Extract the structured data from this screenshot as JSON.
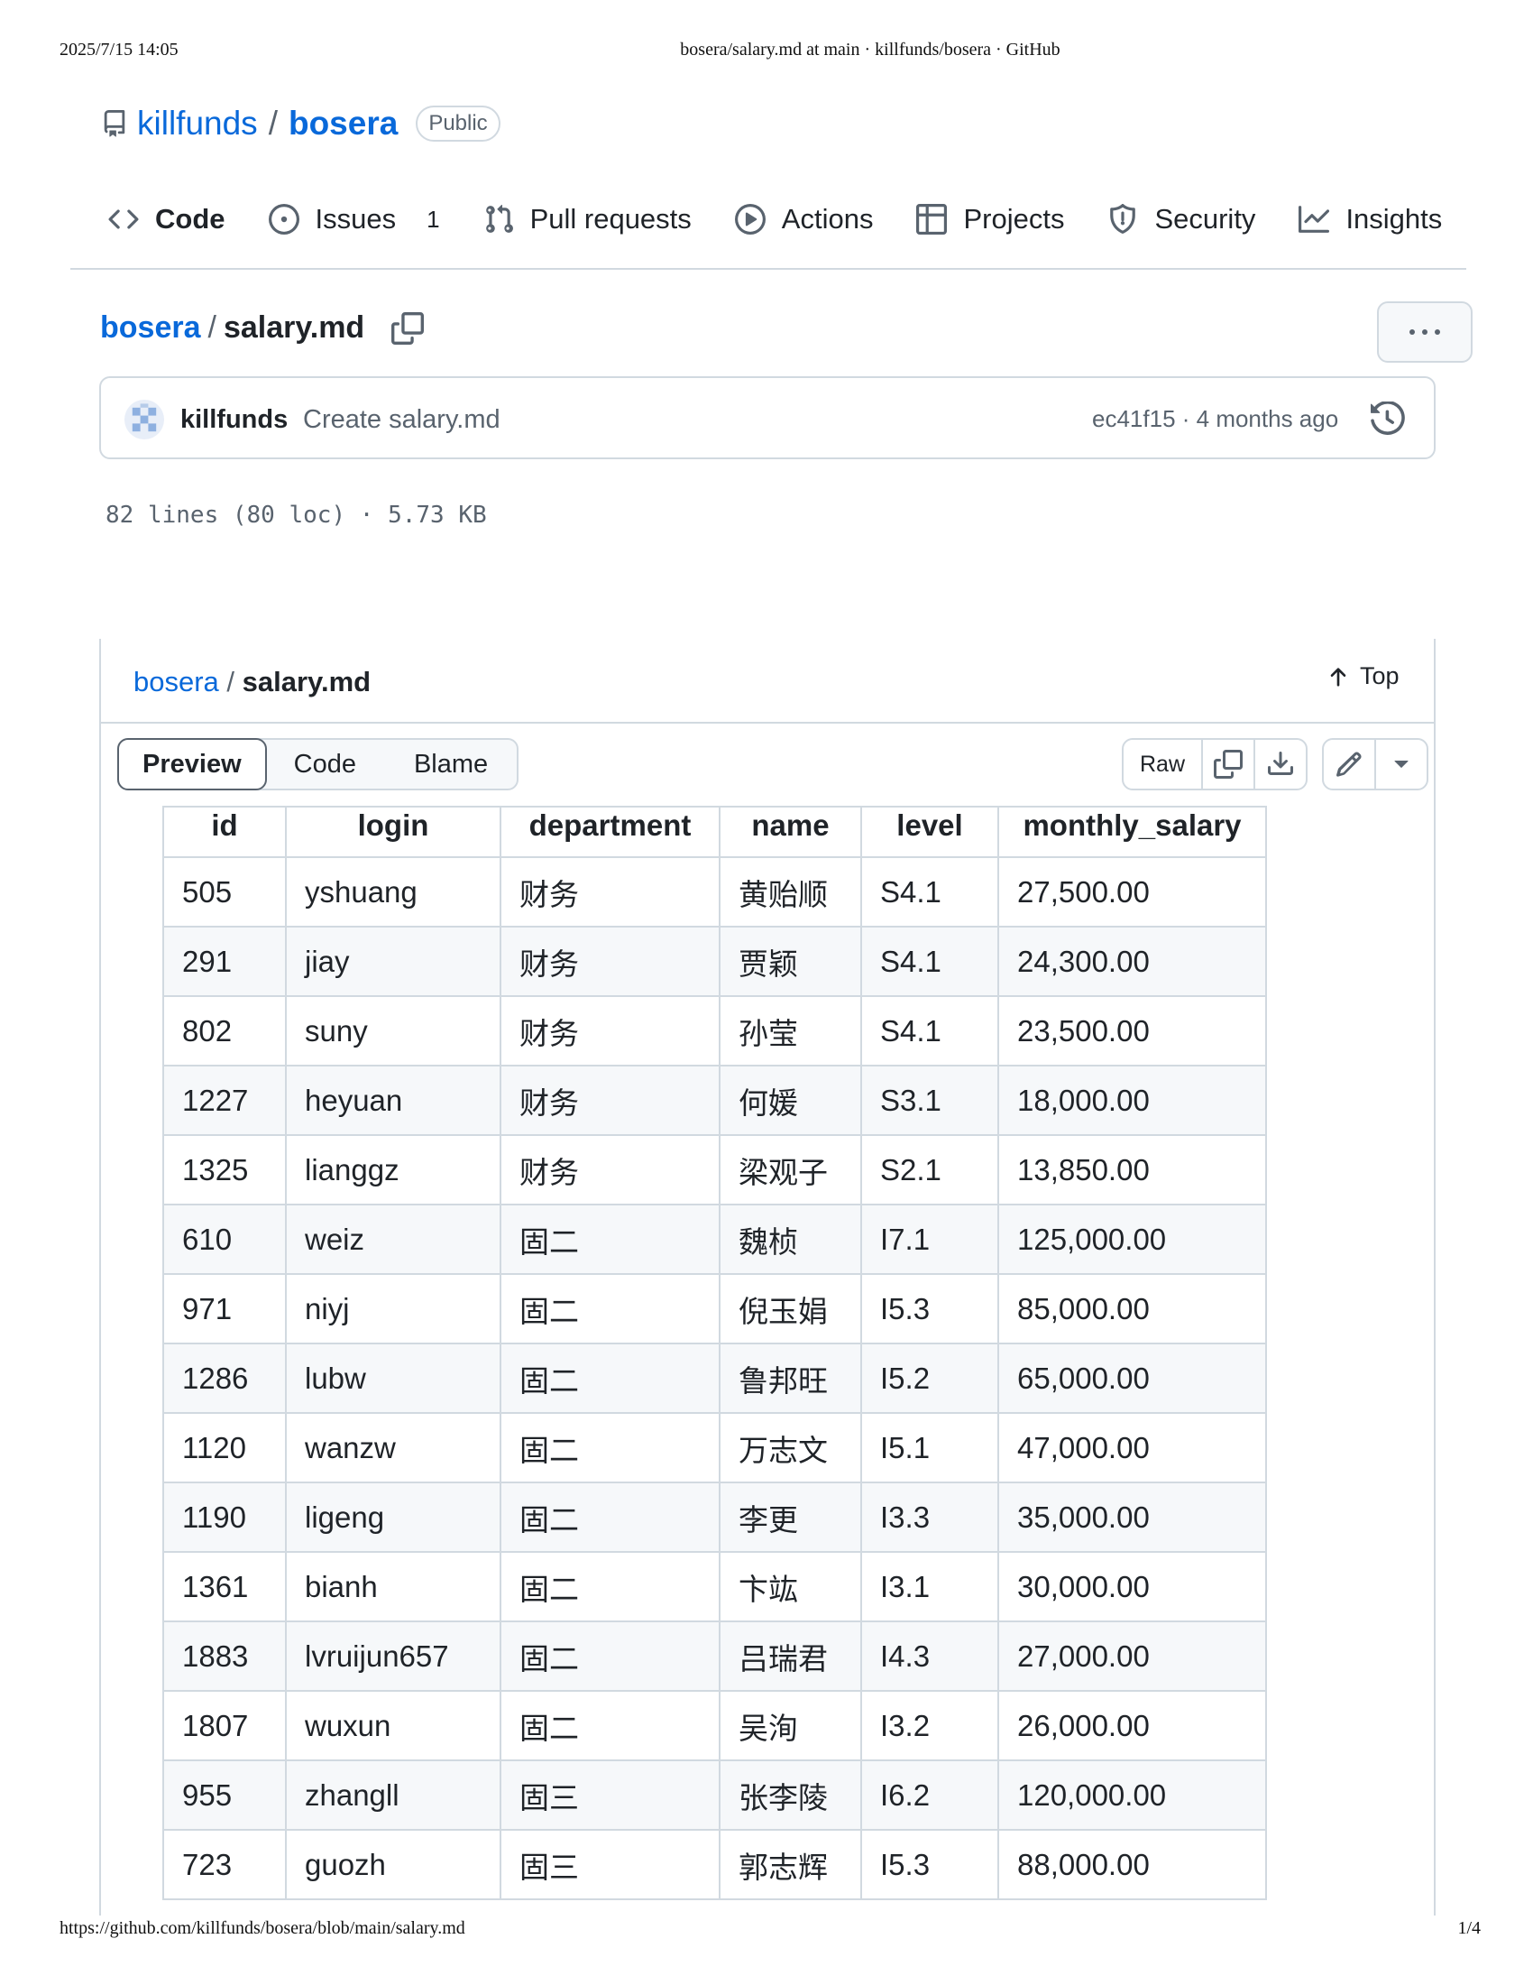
{
  "print_header": {
    "datetime": "2025/7/15 14:05",
    "title": "bosera/salary.md at main · killfunds/bosera · GitHub"
  },
  "print_footer": {
    "url": "https://github.com/killfunds/bosera/blob/main/salary.md",
    "page": "1/4"
  },
  "repo": {
    "owner": "killfunds",
    "name": "bosera",
    "visibility": "Public"
  },
  "nav": {
    "code": "Code",
    "issues": "Issues",
    "issues_count": "1",
    "pull_requests": "Pull requests",
    "actions": "Actions",
    "projects": "Projects",
    "security": "Security",
    "insights": "Insights"
  },
  "file": {
    "repo": "bosera",
    "name": "salary.md",
    "stats": "82 lines (80 loc) · 5.73 KB"
  },
  "commit": {
    "author": "killfunds",
    "message": "Create salary.md",
    "meta": "ec41f15 · 4 months ago"
  },
  "panel": {
    "repo": "bosera",
    "file": "salary.md",
    "top": "Top",
    "tabs": [
      "Preview",
      "Code",
      "Blame"
    ],
    "raw": "Raw"
  },
  "table": {
    "headers": [
      "id",
      "login",
      "department",
      "name",
      "level",
      "monthly_salary"
    ],
    "rows": [
      [
        "505",
        "yshuang",
        "财务",
        "黄贻顺",
        "S4.1",
        "27,500.00"
      ],
      [
        "291",
        "jiay",
        "财务",
        "贾颖",
        "S4.1",
        "24,300.00"
      ],
      [
        "802",
        "suny",
        "财务",
        "孙莹",
        "S4.1",
        "23,500.00"
      ],
      [
        "1227",
        "heyuan",
        "财务",
        "何媛",
        "S3.1",
        "18,000.00"
      ],
      [
        "1325",
        "lianggz",
        "财务",
        "梁观子",
        "S2.1",
        "13,850.00"
      ],
      [
        "610",
        "weiz",
        "固二",
        "魏桢",
        "I7.1",
        "125,000.00"
      ],
      [
        "971",
        "niyj",
        "固二",
        "倪玉娟",
        "I5.3",
        "85,000.00"
      ],
      [
        "1286",
        "lubw",
        "固二",
        "鲁邦旺",
        "I5.2",
        "65,000.00"
      ],
      [
        "1120",
        "wanzw",
        "固二",
        "万志文",
        "I5.1",
        "47,000.00"
      ],
      [
        "1190",
        "ligeng",
        "固二",
        "李更",
        "I3.3",
        "35,000.00"
      ],
      [
        "1361",
        "bianh",
        "固二",
        "卞竑",
        "I3.1",
        "30,000.00"
      ],
      [
        "1883",
        "lvruijun657",
        "固二",
        "吕瑞君",
        "I4.3",
        "27,000.00"
      ],
      [
        "1807",
        "wuxun",
        "固二",
        "吴洵",
        "I3.2",
        "26,000.00"
      ],
      [
        "955",
        "zhangll",
        "固三",
        "张李陵",
        "I6.2",
        "120,000.00"
      ],
      [
        "723",
        "guozh",
        "固三",
        "郭志辉",
        "I5.3",
        "88,000.00"
      ]
    ]
  },
  "colors": {
    "link": "#0969da",
    "border": "#d1d9e0",
    "muted": "#59636e",
    "text": "#1f2328",
    "row_alt": "#f6f8fa"
  }
}
